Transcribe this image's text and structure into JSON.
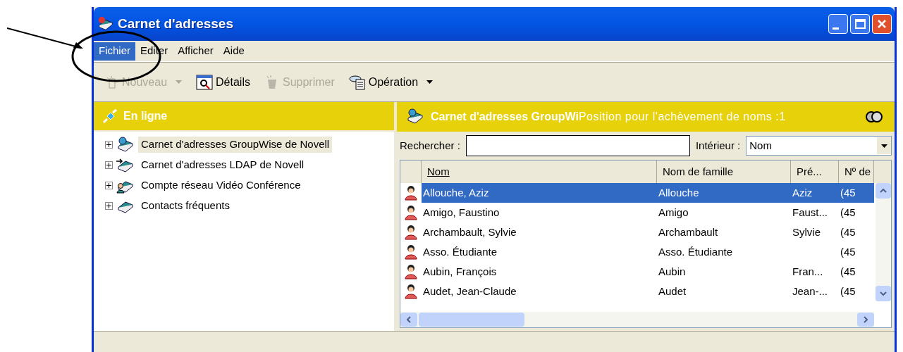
{
  "window": {
    "title": "Carnet d'adresses"
  },
  "menu": [
    {
      "label": "Fichier",
      "selected": true
    },
    {
      "label": "Editer",
      "selected": false
    },
    {
      "label": "Afficher",
      "selected": false
    },
    {
      "label": "Aide",
      "selected": false
    }
  ],
  "toolbar": [
    {
      "label": "Nouveau",
      "kind": "new",
      "disabled": true,
      "dropdown": true
    },
    {
      "label": "Détails",
      "kind": "details",
      "disabled": false,
      "dropdown": false
    },
    {
      "label": "Supprimer",
      "kind": "delete",
      "disabled": true,
      "dropdown": false
    },
    {
      "label": "Opération",
      "kind": "operation",
      "disabled": false,
      "dropdown": true
    }
  ],
  "left_panel": {
    "title": "En ligne",
    "tree": [
      {
        "label": "Carnet d'adresses GroupWise de Novell",
        "kind": "groupwise",
        "selected": true,
        "expanded": false
      },
      {
        "label": "Carnet d'adresses LDAP de Novell",
        "kind": "ldap",
        "selected": false,
        "expanded": false
      },
      {
        "label": "Compte réseau Vidéo Conférence",
        "kind": "account",
        "selected": false,
        "expanded": false
      },
      {
        "label": "Contacts fréquents",
        "kind": "book",
        "selected": false,
        "expanded": false
      }
    ]
  },
  "right_panel": {
    "title": "Carnet d'adresses GroupWi",
    "status": "Position pour l'achèvement de noms :1",
    "search": {
      "label": "Rechercher :"
    },
    "scope": {
      "label": "Intérieur :",
      "value": "Nom"
    },
    "table": {
      "columns": [
        {
          "label": "Nom",
          "sorted": true
        },
        {
          "label": "Nom de famille",
          "sorted": false
        },
        {
          "label": "Pré...",
          "sorted": false
        },
        {
          "label": "Nº de",
          "sorted": false
        }
      ],
      "rows": [
        {
          "cells": [
            "Allouche, Aziz",
            "Allouche",
            "Aziz",
            "(45"
          ],
          "selected": true
        },
        {
          "cells": [
            "Amigo, Faustino",
            "Amigo",
            "Faust...",
            "(45"
          ],
          "selected": false
        },
        {
          "cells": [
            "Archambault, Sylvie",
            "Archambault",
            "Sylvie",
            "(45"
          ],
          "selected": false
        },
        {
          "cells": [
            "Asso. Étudiante",
            "Asso. Étudiante",
            "",
            "(45"
          ],
          "selected": false
        },
        {
          "cells": [
            "Aubin, François",
            "Aubin",
            "Fran...",
            "(45"
          ],
          "selected": false
        },
        {
          "cells": [
            "Audet, Jean-Claude",
            "Audet",
            "Jean-...",
            "(45"
          ],
          "selected": false
        }
      ]
    }
  }
}
